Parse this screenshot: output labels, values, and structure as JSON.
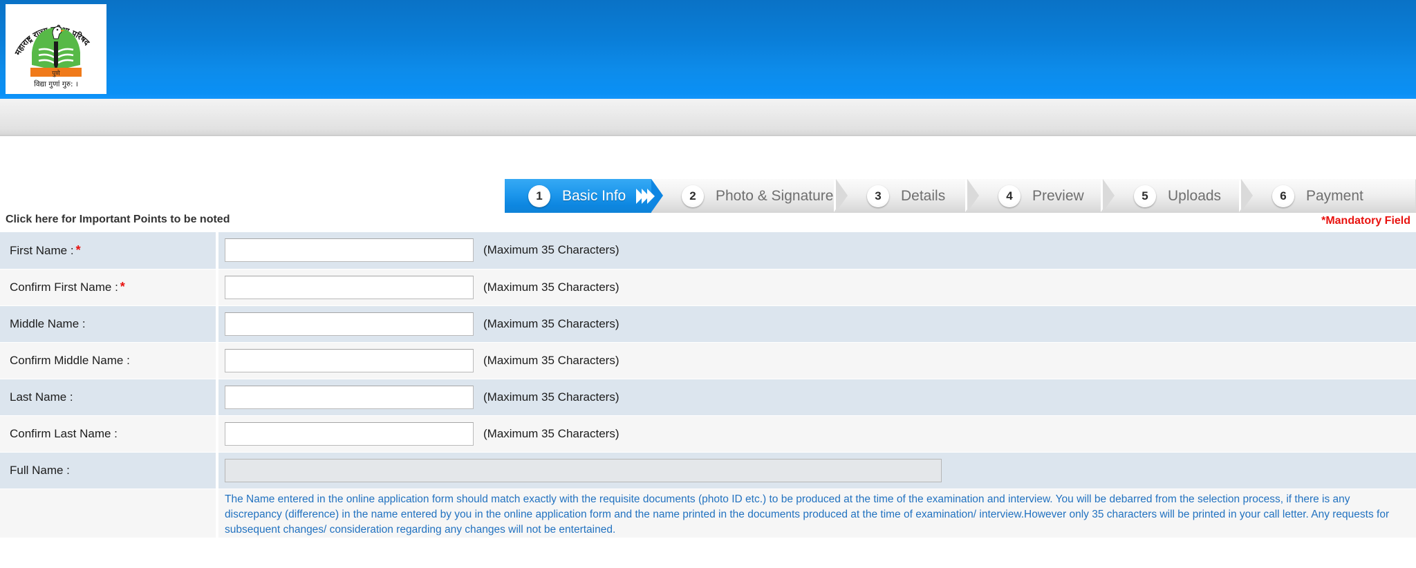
{
  "header": {
    "logo_name": "maharashtra-rajya-pariksha-parishad-logo",
    "logo_alt_top": "महाराष्ट्र राज्य परीक्षा परिषद",
    "logo_city": "पुणे",
    "logo_motto": "विद्या गुणांं गुरु: ।",
    "colors": {
      "blue_top": "#0a72c6",
      "blue_bottom": "#1295fb",
      "grey_bar": "#e8e8e8"
    }
  },
  "steps": [
    {
      "num": "1",
      "label": "Basic Info",
      "active": true
    },
    {
      "num": "2",
      "label": "Photo & Signature",
      "active": false
    },
    {
      "num": "3",
      "label": "Details",
      "active": false
    },
    {
      "num": "4",
      "label": "Preview",
      "active": false
    },
    {
      "num": "5",
      "label": "Uploads",
      "active": false
    },
    {
      "num": "6",
      "label": "Payment",
      "active": false
    }
  ],
  "notice": {
    "click_here": "Click here for Important Points to be noted",
    "mandatory": "*Mandatory Field",
    "mandatory_color": "#e8120f"
  },
  "form": {
    "rows": [
      {
        "label": "First Name :",
        "required": true,
        "value": "",
        "hint": "(Maximum 35 Characters)",
        "disabled": false
      },
      {
        "label": "Confirm First Name :",
        "required": true,
        "value": "",
        "hint": "(Maximum 35 Characters)",
        "disabled": false
      },
      {
        "label": "Middle Name :",
        "required": false,
        "value": "",
        "hint": "(Maximum 35 Characters)",
        "disabled": false
      },
      {
        "label": "Confirm Middle Name :",
        "required": false,
        "value": "",
        "hint": "(Maximum 35 Characters)",
        "disabled": false
      },
      {
        "label": "Last Name :",
        "required": false,
        "value": "",
        "hint": "(Maximum 35 Characters)",
        "disabled": false
      },
      {
        "label": "Confirm Last Name :",
        "required": false,
        "value": "",
        "hint": "(Maximum 35 Characters)",
        "disabled": false
      },
      {
        "label": "Full Name :",
        "required": false,
        "value": "",
        "hint": "",
        "disabled": true
      }
    ],
    "note": "The Name entered in the online application form should match exactly with the requisite documents (photo ID etc.) to be produced at the time of the examination and interview. You will be debarred from the selection process, if there is any discrepancy (difference) in the name entered by you in the online application form and the name printed in the documents produced at the time of examination/ interview.However only 35 characters will be printed in your call letter. Any requests for subsequent changes/ consideration regarding any changes will not be entertained.",
    "note_color": "#2272c0"
  }
}
